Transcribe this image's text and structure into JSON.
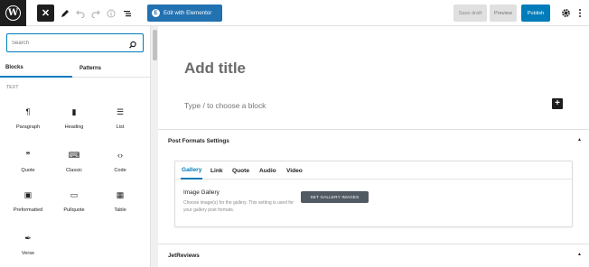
{
  "toolbar": {
    "close_symbol": "✕",
    "edit_elementor_label": "Edit with Elementor",
    "elementor_badge": "E",
    "save_draft_label": "Save draft",
    "preview_label": "Preview",
    "publish_label": "Publish",
    "icons": [
      "wordpress-logo",
      "close-icon",
      "pencil-icon",
      "undo-icon",
      "redo-icon",
      "info-icon",
      "list-view-icon",
      "gear-icon",
      "more-vertical-icon"
    ],
    "accent_color": "#007cba"
  },
  "sidebar": {
    "search_placeholder": "Search",
    "tabs": [
      {
        "label": "Blocks",
        "active": true
      },
      {
        "label": "Patterns",
        "active": false
      }
    ],
    "category_label": "TEXT",
    "blocks": [
      {
        "label": "Paragraph",
        "icon": "¶"
      },
      {
        "label": "Heading",
        "icon": "▮"
      },
      {
        "label": "List",
        "icon": "☰"
      },
      {
        "label": "Quote",
        "icon": "❞"
      },
      {
        "label": "Classic",
        "icon": "⌨"
      },
      {
        "label": "Code",
        "icon": "‹›"
      },
      {
        "label": "Preformatted",
        "icon": "▣"
      },
      {
        "label": "Pullquote",
        "icon": "▭"
      },
      {
        "label": "Table",
        "icon": "▦"
      },
      {
        "label": "Verse",
        "icon": "✒"
      }
    ]
  },
  "editor": {
    "title_placeholder": "Add title",
    "block_placeholder": "Type / to choose a block",
    "add_block_symbol": "+"
  },
  "metaboxes": {
    "post_formats": {
      "title": "Post Formats Settings",
      "tabs": [
        "Gallery",
        "Link",
        "Quote",
        "Audio",
        "Video"
      ],
      "active_tab": "Gallery",
      "field_title": "Image Gallery",
      "field_description": "Choose image(s) for the gallery. This setting is used for your gallery post formats.",
      "button_label": "SET GALLERY IMAGES"
    },
    "jetreviews": {
      "title": "JetReviews"
    }
  }
}
